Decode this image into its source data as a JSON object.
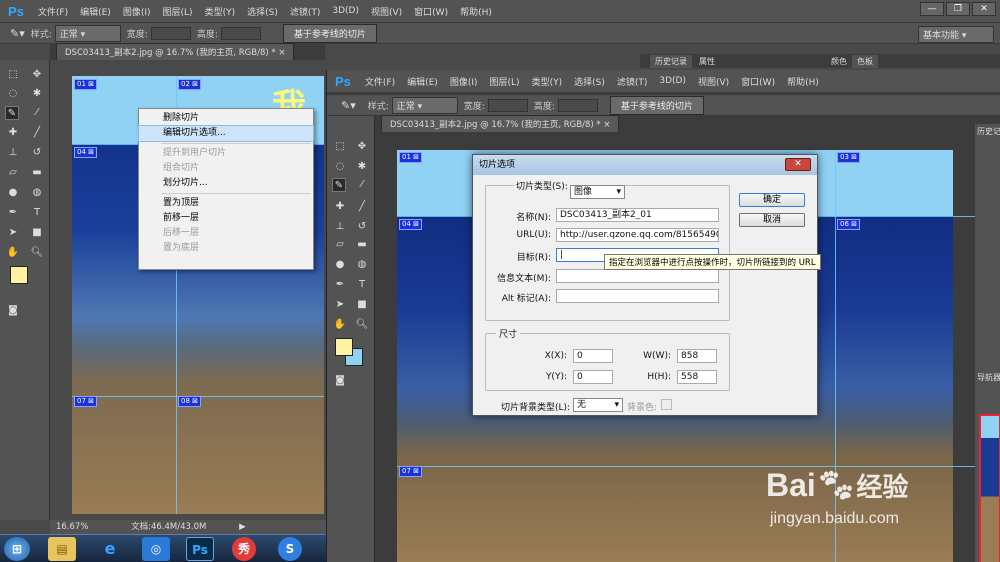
{
  "back_window": {
    "menu": [
      "文件(F)",
      "编辑(E)",
      "图像(I)",
      "图层(L)",
      "类型(Y)",
      "选择(S)",
      "滤镜(T)",
      "3D(D)",
      "视图(V)",
      "窗口(W)",
      "帮助(H)"
    ],
    "options": {
      "style_label": "样式:",
      "style_value": "正常",
      "width_label": "宽度:",
      "height_label": "高度:",
      "slice_guides_button": "基于参考线的切片",
      "workspace": "基本功能"
    },
    "doc_tab": "DSC03413_副本2.jpg @ 16.7% (我的主页, RGB/8) *",
    "panel_tabs": [
      "历史记录",
      "属性"
    ],
    "color_tabs": [
      "颜色",
      "色板"
    ],
    "slice_numbers": [
      "01",
      "02",
      "04",
      "07",
      "08"
    ],
    "status_zoom": "16.67%",
    "status_doc": "文档:46.4M/43.0M",
    "context_menu": [
      {
        "label": "删除切片",
        "disabled": false
      },
      {
        "label": "编辑切片选项...",
        "disabled": false,
        "highlighted": true
      },
      {
        "label": "提升到用户切片",
        "disabled": true
      },
      {
        "label": "组合切片",
        "disabled": true
      },
      {
        "label": "划分切片...",
        "disabled": false
      },
      {
        "label": "置为顶层",
        "disabled": false
      },
      {
        "label": "前移一层",
        "disabled": false
      },
      {
        "label": "后移一层",
        "disabled": true
      },
      {
        "label": "置为底层",
        "disabled": true
      }
    ]
  },
  "front_window": {
    "menu": [
      "文件(F)",
      "编辑(E)",
      "图像(I)",
      "图层(L)",
      "类型(Y)",
      "选择(S)",
      "滤镜(T)",
      "3D(D)",
      "视图(V)",
      "窗口(W)",
      "帮助(H)"
    ],
    "options": {
      "style_label": "样式:",
      "style_value": "正常",
      "width_label": "宽度:",
      "height_label": "高度:",
      "slice_guides_button": "基于参考线的切片"
    },
    "doc_tab": "DSC03413_副本2.jpg @ 16.7% (我的主页, RGB/8) *",
    "panel_tab": "历史记",
    "navigator_tab": "导航器",
    "slice_numbers": [
      "01",
      "03",
      "04",
      "06",
      "07"
    ]
  },
  "dialog": {
    "title": "切片选项",
    "slice_type_label": "切片类型(S):",
    "slice_type_value": "图像",
    "name_label": "名称(N):",
    "name_value": "DSC03413_副本2_01",
    "url_label": "URL(U):",
    "url_value": "http://user.qzone.qq.com/81565490",
    "target_label": "目标(R):",
    "target_value": "",
    "message_label": "信息文本(M):",
    "alt_label": "Alt 标记(A):",
    "size_group": "尺寸",
    "x_label": "X(X):",
    "x_value": "0",
    "y_label": "Y(Y):",
    "y_value": "0",
    "w_label": "W(W):",
    "w_value": "858",
    "h_label": "H(H):",
    "h_value": "558",
    "bg_type_label": "切片背景类型(L):",
    "bg_type_value": "无",
    "bg_color_label": "背景色:",
    "ok_button": "确定",
    "cancel_button": "取消",
    "tooltip": "指定在浏览器中进行点按操作时，切片所链接到的 URL"
  },
  "watermark": {
    "brand": "Bai",
    "brand_suffix": "经验",
    "url": "jingyan.baidu.com"
  },
  "colors": {
    "sky": "#8fd2f4",
    "slice_badge": "#1a33d8",
    "ps_blue": "#31a8ff"
  }
}
